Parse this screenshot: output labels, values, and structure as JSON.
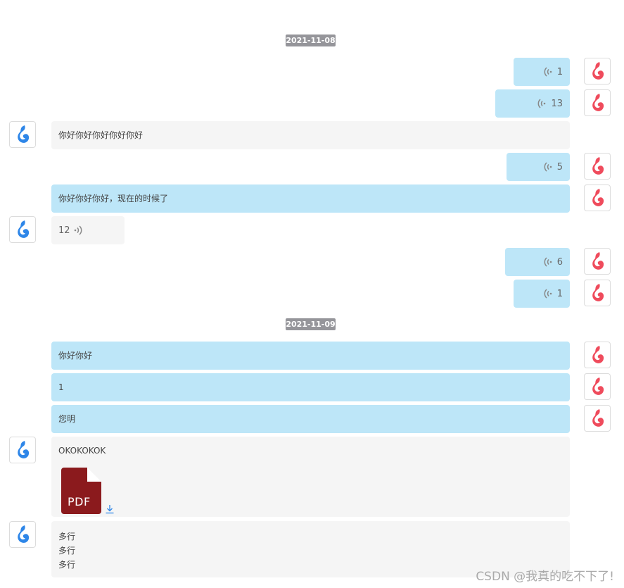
{
  "dates": [
    "2021-11-08",
    "2021-11-09"
  ],
  "messages": {
    "m1": {
      "value": "1"
    },
    "m2": {
      "value": "13"
    },
    "m3": {
      "text": "你好你好你好你好你好"
    },
    "m4": {
      "value": "5"
    },
    "m5": {
      "text": "你好你好你好，现在的时候了"
    },
    "m6": {
      "value": "12"
    },
    "m7": {
      "value": "6"
    },
    "m8": {
      "value": "1"
    },
    "m9": {
      "text": "你好你好"
    },
    "m10": {
      "text": "1"
    },
    "m11": {
      "text": "您明"
    },
    "m12": {
      "text": "OKOKOKOK",
      "file_type": "PDF"
    },
    "m13": {
      "lines": [
        "多行",
        "多行",
        "多行"
      ]
    }
  },
  "watermark": "CSDN @我真的吃不下了!",
  "colors": {
    "my_bubble": "#bde6f8",
    "other_bubble": "#f5f5f5",
    "my_avatar": "#ef4b5c",
    "other_avatar": "#2e86e8",
    "date_badge": "#95959a",
    "pdf": "#8b1a1d"
  },
  "icons": {
    "my_avatar": "red-flame-logo-icon",
    "other_avatar": "blue-flame-logo-icon",
    "voice": "voice-wave-icon",
    "download": "download-icon"
  }
}
